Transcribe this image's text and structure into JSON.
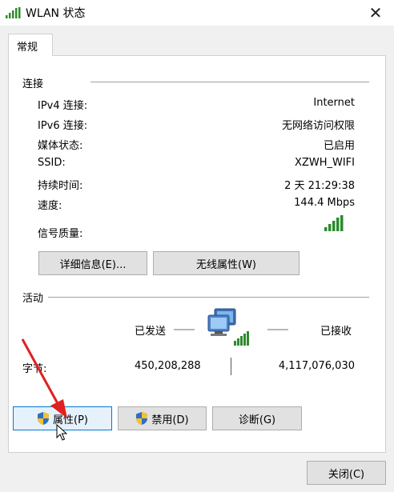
{
  "window": {
    "title": "WLAN 状态",
    "title_icon": "wifi-signal-icon",
    "close_glyph": "✕"
  },
  "tab": {
    "label": "常规"
  },
  "connection": {
    "group_label": "连接",
    "rows": [
      {
        "label": "IPv4 连接:",
        "value": "Internet"
      },
      {
        "label": "IPv6 连接:",
        "value": "无网络访问权限"
      },
      {
        "label": "媒体状态:",
        "value": "已启用"
      },
      {
        "label": "SSID:",
        "value": "XZWH_WIFI"
      },
      {
        "label": "持续时间:",
        "value": "2 天 21:29:38"
      },
      {
        "label": "速度:",
        "value": "144.4 Mbps"
      }
    ],
    "signal_label": "信号质量:",
    "signal_icon": "signal-strength-icon",
    "details_button": "详细信息(E)...",
    "wireless_props_button": "无线属性(W)"
  },
  "activity": {
    "group_label": "活动",
    "sent_label": "已发送",
    "received_label": "已接收",
    "bytes_label": "字节:",
    "bytes_sent": "450,208,288",
    "bytes_received": "4,117,076,030",
    "network_icon": "network-computers-icon"
  },
  "buttons": {
    "properties": "属性(P)",
    "disable": "禁用(D)",
    "diagnose": "诊断(G)",
    "close": "关闭(C)"
  },
  "colors": {
    "signal_green": "#2e8b2e",
    "annotation_red": "#e02020",
    "focus_blue": "#0078d7"
  }
}
